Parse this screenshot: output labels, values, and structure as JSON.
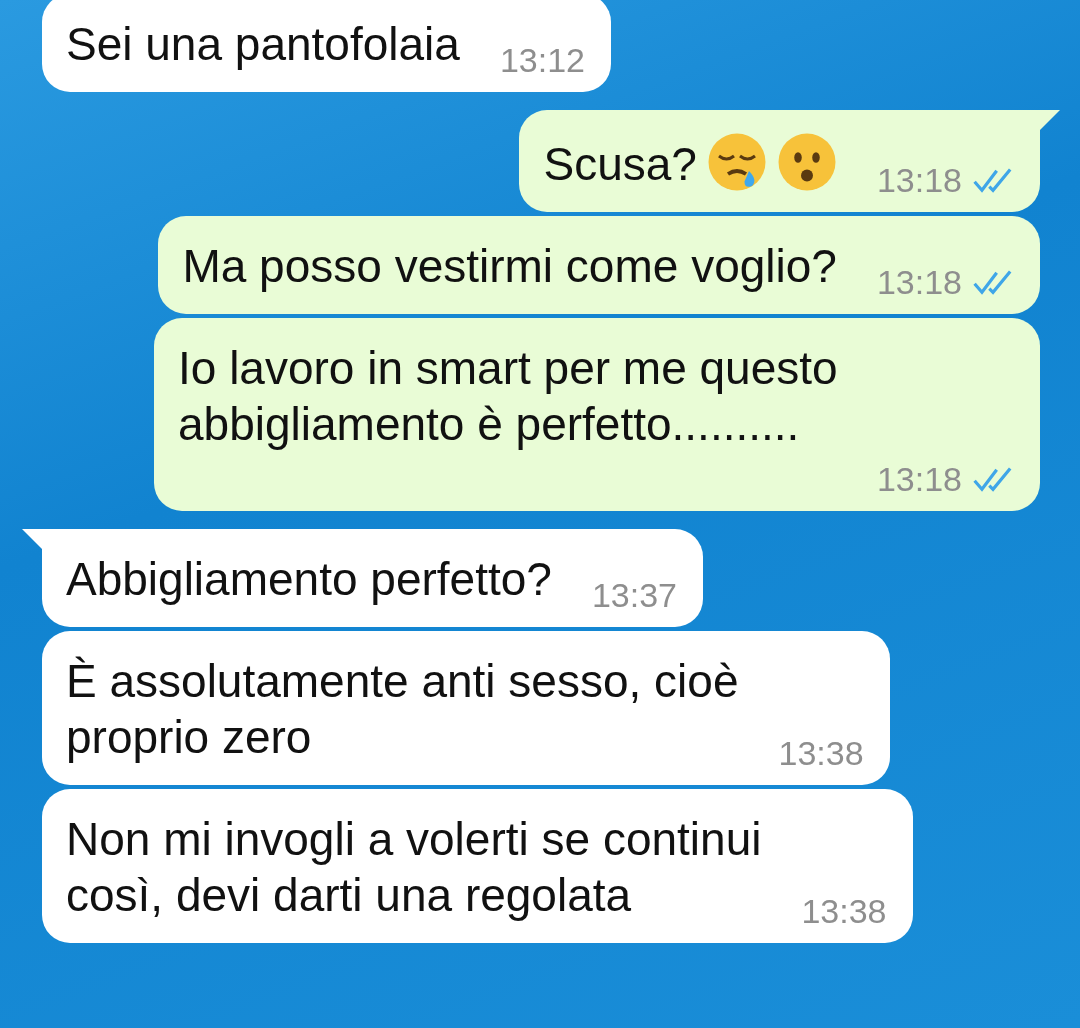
{
  "messages": [
    {
      "kind": "received",
      "tail": false,
      "text": "Sei una pantofolaia",
      "time": "13:12"
    },
    {
      "kind": "sent",
      "tail": true,
      "text": "Scusa?",
      "emoji": [
        {
          "kind": "sleepy"
        },
        {
          "kind": "frowning"
        }
      ],
      "time": "13:18",
      "read": true
    },
    {
      "kind": "sent",
      "tail": false,
      "text": "Ma posso vestirmi come voglio?",
      "time": "13:18",
      "read": true
    },
    {
      "kind": "sent",
      "tail": false,
      "text": "Io lavoro in smart per me questo\nabbigliamento è perfetto..........",
      "time": "13:18",
      "read": true
    },
    {
      "kind": "received",
      "tail": true,
      "text": "Abbigliamento perfetto?",
      "time": "13:37"
    },
    {
      "kind": "received",
      "tail": false,
      "text": "È assolutamente anti sesso, cioè\nproprio zero",
      "time": "13:38"
    },
    {
      "kind": "received",
      "tail": false,
      "text": "Non mi invogli a volerti se continui\ncosì, devi darti una regolata",
      "time": "13:38"
    }
  ]
}
